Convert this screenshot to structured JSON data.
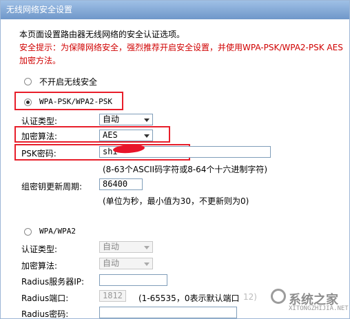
{
  "window": {
    "title": "无线网络安全设置"
  },
  "intro": {
    "line1": "本页面设置路由器无线网络的安全认证选项。",
    "tip_line1": "安全提示：为保障网络安全，强烈推荐开启安全设置，并使用WPA-PSK/WPA2-PSK AES",
    "tip_line2": "加密方法。"
  },
  "options": {
    "off_label": "不开启无线安全",
    "wpa_psk_label": "WPA-PSK/WPA2-PSK",
    "wpa_label": "WPA/WPA2",
    "selected": "WPA-PSK/WPA2-PSK"
  },
  "psk": {
    "auth_type_label": "认证类型:",
    "auth_type_value": "自动",
    "encryption_label": "加密算法:",
    "encryption_value": "AES",
    "password_label": "PSK密码:",
    "password_value": "shi",
    "password_hint": "(8-63个ASCII码字符或8-64个十六进制字符)",
    "rekey_label": "组密钥更新周期:",
    "rekey_value": "86400",
    "rekey_hint": "(单位为秒，最小值为30，不更新则为0)"
  },
  "wpa": {
    "auth_type_label": "认证类型:",
    "auth_type_value": "自动",
    "encryption_label": "加密算法:",
    "encryption_value": "自动",
    "radius_ip_label": "Radius服务器IP:",
    "radius_ip_value": "",
    "radius_port_label": "Radius端口:",
    "radius_port_value": "1812",
    "radius_port_hint": "(1-65535，0表示默认端口",
    "radius_port_hint_tail": "12)",
    "radius_password_label": "Radius密码:",
    "radius_password_value": ""
  },
  "watermark": {
    "text": "系统之家",
    "subtext": "XITONGZHIJIA.NET"
  },
  "colors": {
    "title_bar": "#7fa6d6",
    "tip_text": "#d00000",
    "highlight": "#e81e2a"
  }
}
